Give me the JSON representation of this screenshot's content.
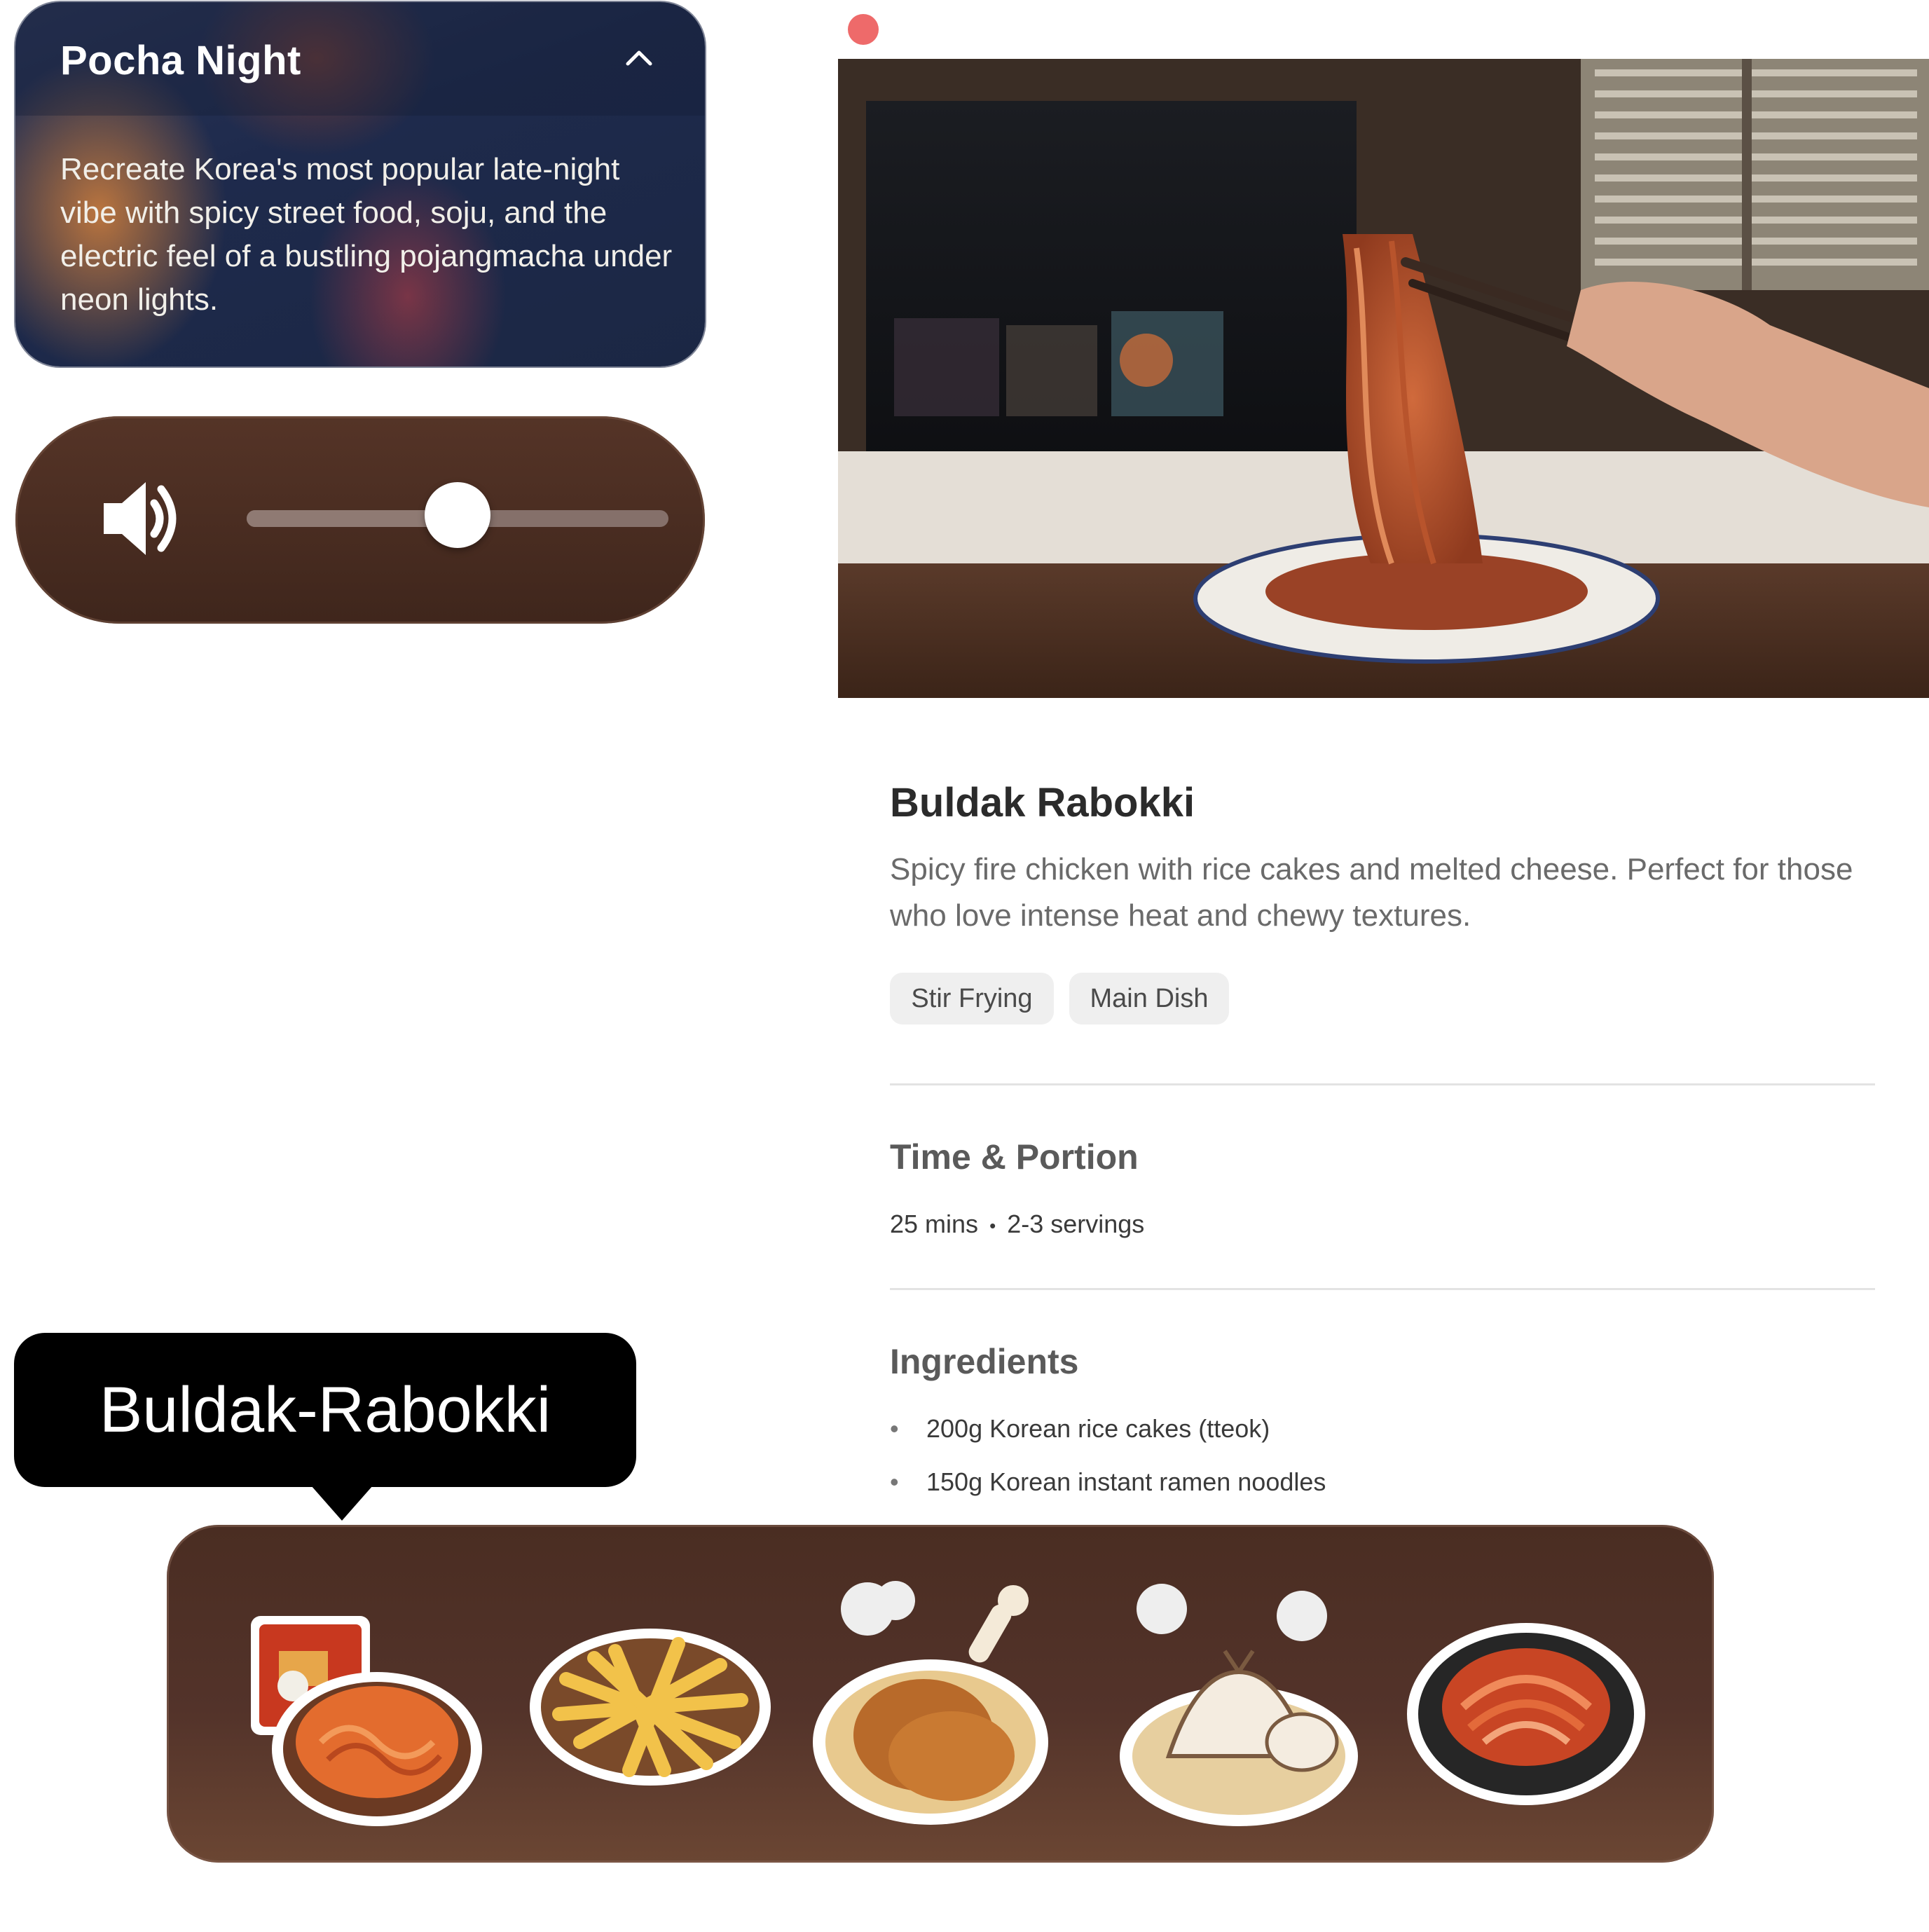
{
  "pocha": {
    "title": "Pocha Night",
    "description": "Recreate Korea's most popular late-night vibe with spicy street food, soju, and the electric feel of a bustling pojangmacha under neon lights."
  },
  "volume": {
    "level": 0.5
  },
  "recipe": {
    "title": "Buldak Rabokki",
    "description": "Spicy fire chicken with rice cakes and melted cheese. Perfect for those who love intense heat and chewy textures.",
    "tags": [
      "Stir Frying",
      "Main Dish"
    ],
    "time_portion_title": "Time & Portion",
    "time": "25 mins",
    "separator": "•",
    "servings": "2-3 servings",
    "ingredients_title": "Ingredients",
    "ingredients": [
      "200g Korean rice cakes (tteok)",
      "150g Korean instant ramen noodles"
    ]
  },
  "tooltip": {
    "label": "Buldak-Rabokki"
  },
  "dock": {
    "items": [
      {
        "icon": "buldak-rabokki-icon"
      },
      {
        "icon": "fries-icon"
      },
      {
        "icon": "fried-chicken-icon"
      },
      {
        "icon": "dumplings-icon"
      },
      {
        "icon": "kimchi-icon"
      }
    ]
  },
  "colors": {
    "close_button": "#ee6a6a",
    "dock_bg": "#4a2d22",
    "volume_bg": "#553427",
    "card_bg": "#1e2a4c"
  }
}
